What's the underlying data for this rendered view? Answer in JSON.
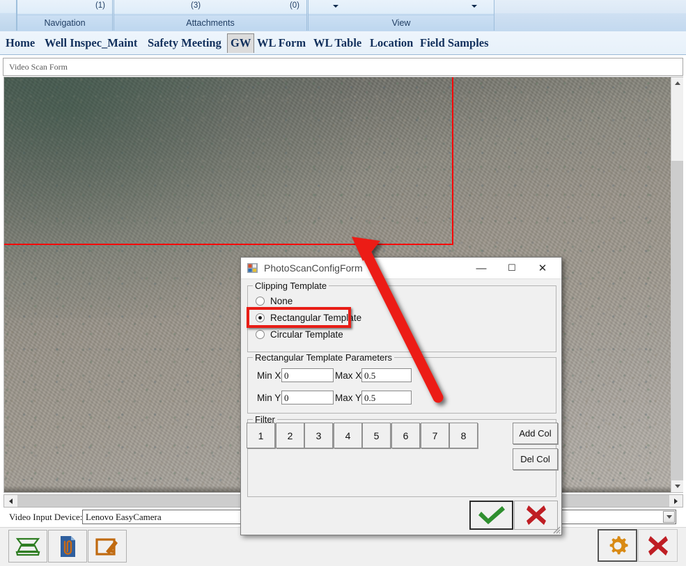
{
  "ribbon": {
    "groups": [
      {
        "name": "Navigation",
        "counts": [
          {
            "text": "(1)",
            "align": "right"
          }
        ]
      },
      {
        "name": "Attachments",
        "counts": [
          {
            "text": "(3)",
            "align": "left"
          },
          {
            "text": "(0)",
            "align": "right"
          }
        ]
      },
      {
        "name": "View",
        "counts": []
      }
    ]
  },
  "tabs": [
    {
      "label": "Home",
      "selected": false
    },
    {
      "label": "Well Inspec_Maint",
      "selected": false
    },
    {
      "label": "Safety Meeting",
      "selected": false
    },
    {
      "label": "GW",
      "selected": true
    },
    {
      "label": "WL Form",
      "selected": false
    },
    {
      "label": "WL Table",
      "selected": false
    },
    {
      "label": "Location",
      "selected": false
    },
    {
      "label": "Field Samples",
      "selected": false
    }
  ],
  "form_header": {
    "title": "Video Scan Form"
  },
  "device_row": {
    "label": "Video Input Device:",
    "value": "Lenovo EasyCamera",
    "options": [
      "Lenovo EasyCamera"
    ]
  },
  "bottom_toolbar": {
    "buttons": [
      {
        "name": "scanner-button",
        "icon": "scanner-icon"
      },
      {
        "name": "attach-document-button",
        "icon": "document-paperclip-icon"
      },
      {
        "name": "edit-form-button",
        "icon": "form-edit-icon"
      }
    ],
    "right_buttons": [
      {
        "name": "settings-button",
        "icon": "gear-icon"
      },
      {
        "name": "close-button",
        "icon": "red-x-icon"
      }
    ]
  },
  "dialog": {
    "title": "PhotoScanConfigForm",
    "window_buttons": {
      "minimize": "—",
      "maximize": "☐",
      "close": "✕"
    },
    "clipping_template": {
      "caption": "Clipping Template",
      "options": [
        {
          "label": "None",
          "selected": false,
          "highlighted": false
        },
        {
          "label": "Rectangular Template",
          "selected": true,
          "highlighted": true
        },
        {
          "label": "Circular Template",
          "selected": false,
          "highlighted": false
        }
      ]
    },
    "rect_params": {
      "caption": "Rectangular Template Parameters",
      "fields": [
        {
          "label": "Min X",
          "value": "0"
        },
        {
          "label": "Max X",
          "value": "0.5"
        },
        {
          "label": "Min Y",
          "value": "0"
        },
        {
          "label": "Max Y",
          "value": "0.5"
        }
      ]
    },
    "filter": {
      "caption": "Filter",
      "numbers": [
        "1",
        "2",
        "3",
        "4",
        "5",
        "6",
        "7",
        "8"
      ],
      "add_col": "Add Col",
      "del_col": "Del Col"
    },
    "actions": {
      "ok": "check-icon",
      "cancel": "red-x-icon"
    }
  },
  "colors": {
    "ribbon_blue": "#c3d9ef",
    "tab_text": "#12305c",
    "highlight_red": "#e81d16",
    "arrow_red": "#ec1c16",
    "crosshair_red": "#f90606",
    "ok_green": "#2f8f2f",
    "cancel_red": "#bf1e24",
    "gear_orange": "#d98a14"
  },
  "annotation": {
    "arrow": "red-arrow-pointing-to-crosshair",
    "highlight_box": "red-rectangle-around-rectangular-template"
  }
}
